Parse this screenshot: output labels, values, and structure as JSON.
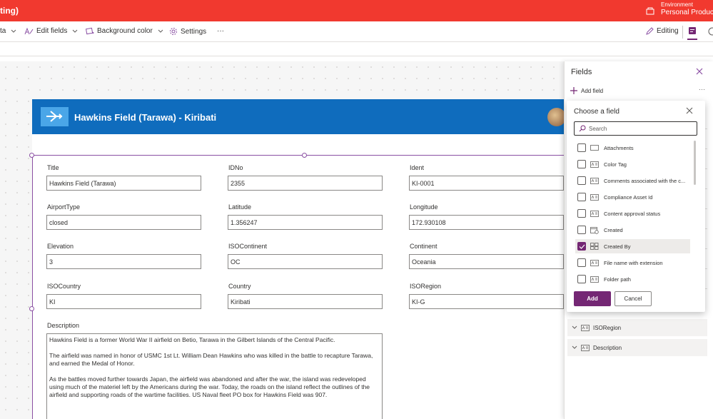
{
  "topbar": {
    "title": "ting)",
    "env_label": "Environment",
    "env_value": "Personal Productiv"
  },
  "commandbar": {
    "data_partial": "ta",
    "edit_fields": "Edit fields",
    "background_color": "Background color",
    "settings": "Settings",
    "more": "···",
    "editing": "Editing"
  },
  "form": {
    "title": "Hawkins Field (Tarawa) - Kiribati",
    "fields": [
      {
        "label": "Title",
        "value": "Hawkins Field (Tarawa)"
      },
      {
        "label": "IDNo",
        "value": "2355"
      },
      {
        "label": "Ident",
        "value": "KI-0001"
      },
      {
        "label": "AirportType",
        "value": "closed"
      },
      {
        "label": "Latitude",
        "value": "1.356247"
      },
      {
        "label": "Longitude",
        "value": "172.930108"
      },
      {
        "label": "Elevation",
        "value": "3"
      },
      {
        "label": "ISOContinent",
        "value": "OC"
      },
      {
        "label": "Continent",
        "value": "Oceania"
      },
      {
        "label": "ISOCountry",
        "value": "KI"
      },
      {
        "label": "Country",
        "value": "Kiribati"
      },
      {
        "label": "ISORegion",
        "value": "KI-G"
      }
    ],
    "description_label": "Description",
    "description": [
      "Hawkins Field is a former World War II airfield on Betio, Tarawa in the Gilbert Islands of the Central Pacific.",
      "The airfield was named in honor of USMC 1st Lt. William Dean Hawkins who was killed in the battle to recapture Tarawa, and earned the Medal of Honor.",
      "As the battles moved further towards Japan, the airfield was abandoned and after the war, the island was redeveloped using much of the materiel left by the Americans during the war. Today, the roads on the island reflect the outlines of the airfield and supporting roads of the wartime facilities. US Naval fleet PO box for Hawkins Field was 907."
    ]
  },
  "fields_pane": {
    "title": "Fields",
    "add_field": "Add field",
    "more": "···",
    "groups": [
      {
        "label": "ISORegion",
        "icon": "text-field-icon"
      },
      {
        "label": "Description",
        "icon": "text-field-icon"
      }
    ]
  },
  "choose_field": {
    "title": "Choose a field",
    "search_placeholder": "Search",
    "options": [
      {
        "label": "Attachments",
        "icon": "attachment-field-icon",
        "checked": false
      },
      {
        "label": "Color Tag",
        "icon": "text-field-icon",
        "checked": false
      },
      {
        "label": "Comments associated with the c...",
        "icon": "text-field-icon",
        "checked": false
      },
      {
        "label": "Compliance Asset Id",
        "icon": "text-field-icon",
        "checked": false
      },
      {
        "label": "Content approval status",
        "icon": "text-field-icon",
        "checked": false
      },
      {
        "label": "Created",
        "icon": "calendar-field-icon",
        "checked": false
      },
      {
        "label": "Created By",
        "icon": "person-field-icon",
        "checked": true
      },
      {
        "label": "File name with extension",
        "icon": "text-field-icon",
        "checked": false
      },
      {
        "label": "Folder path",
        "icon": "text-field-icon",
        "checked": false
      }
    ],
    "add_label": "Add",
    "cancel_label": "Cancel"
  },
  "colors": {
    "topbar": "#f1392f",
    "form_header": "#0f6cbd",
    "accent": "#742774"
  }
}
